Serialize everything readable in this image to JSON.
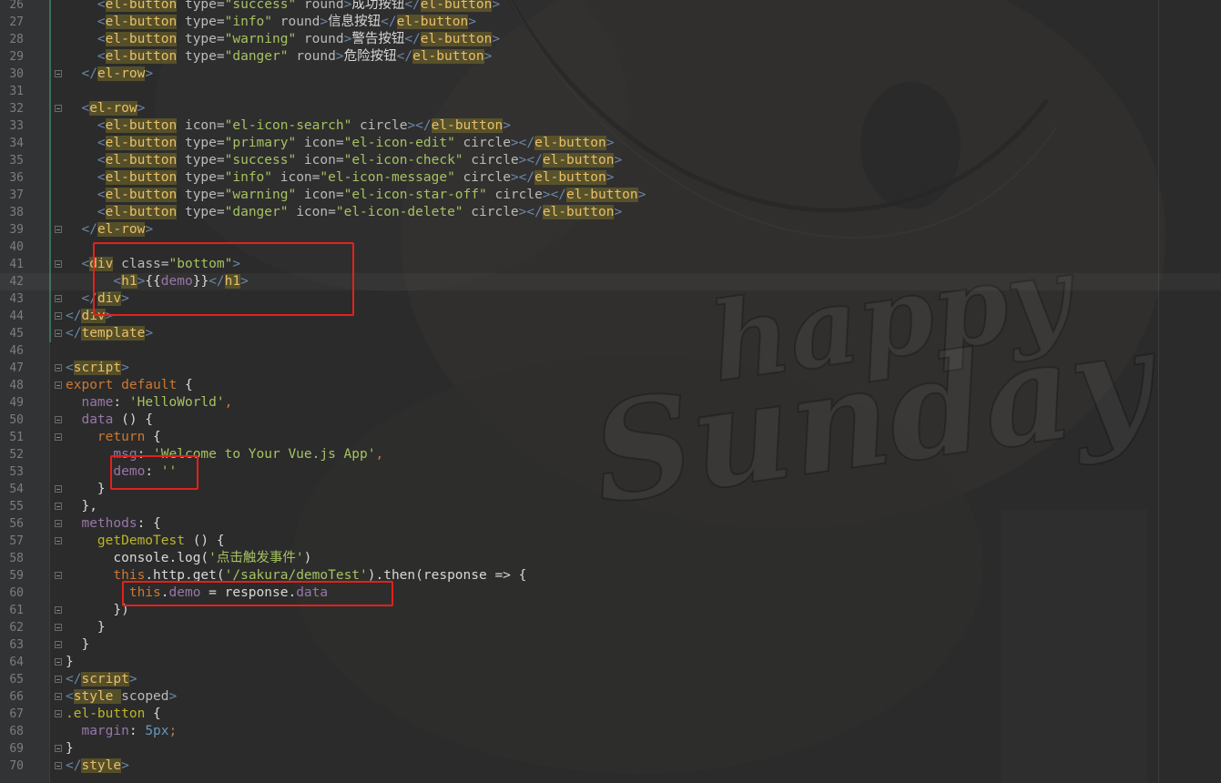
{
  "editor": {
    "watermark_lines": [
      "happy",
      "Sunday"
    ],
    "colors": {
      "background": "#2b2b2b",
      "tag": "#e8bf6a",
      "string": "#a5c261",
      "keyword": "#cc7832",
      "property": "#9876aa",
      "number": "#6897bb",
      "highlight_box": "#e3211c"
    },
    "lines": [
      {
        "n": "26",
        "fold": false,
        "t": [
          [
            "    ",
            ""
          ],
          [
            "<",
            "br"
          ],
          [
            "el-button",
            "tg"
          ],
          [
            " type=",
            "at"
          ],
          [
            "\"success\"",
            "sv"
          ],
          [
            " round",
            "at"
          ],
          [
            ">",
            "br"
          ],
          [
            "成功按钮",
            "tx"
          ],
          [
            "</",
            "br"
          ],
          [
            "el-button",
            "tg"
          ],
          [
            ">",
            "br"
          ]
        ]
      },
      {
        "n": "27",
        "fold": false,
        "t": [
          [
            "    ",
            ""
          ],
          [
            "<",
            "br"
          ],
          [
            "el-button",
            "tg"
          ],
          [
            " type=",
            "at"
          ],
          [
            "\"info\"",
            "sv"
          ],
          [
            " round",
            "at"
          ],
          [
            ">",
            "br"
          ],
          [
            "信息按钮",
            "tx"
          ],
          [
            "</",
            "br"
          ],
          [
            "el-button",
            "tg"
          ],
          [
            ">",
            "br"
          ]
        ]
      },
      {
        "n": "28",
        "fold": false,
        "t": [
          [
            "    ",
            ""
          ],
          [
            "<",
            "br"
          ],
          [
            "el-button",
            "tg"
          ],
          [
            " type=",
            "at"
          ],
          [
            "\"warning\"",
            "sv"
          ],
          [
            " round",
            "at"
          ],
          [
            ">",
            "br"
          ],
          [
            "警告按钮",
            "tx"
          ],
          [
            "</",
            "br"
          ],
          [
            "el-button",
            "tg"
          ],
          [
            ">",
            "br"
          ]
        ]
      },
      {
        "n": "29",
        "fold": false,
        "t": [
          [
            "    ",
            ""
          ],
          [
            "<",
            "br"
          ],
          [
            "el-button",
            "tg"
          ],
          [
            " type=",
            "at"
          ],
          [
            "\"danger\"",
            "sv"
          ],
          [
            " round",
            "at"
          ],
          [
            ">",
            "br"
          ],
          [
            "危险按钮",
            "tx"
          ],
          [
            "</",
            "br"
          ],
          [
            "el-button",
            "tg"
          ],
          [
            ">",
            "br"
          ]
        ]
      },
      {
        "n": "30",
        "fold": true,
        "t": [
          [
            "  ",
            ""
          ],
          [
            "</",
            "br"
          ],
          [
            "el-row",
            "tg"
          ],
          [
            ">",
            "br"
          ]
        ]
      },
      {
        "n": "31",
        "fold": false,
        "t": []
      },
      {
        "n": "32",
        "fold": true,
        "t": [
          [
            "  ",
            ""
          ],
          [
            "<",
            "br"
          ],
          [
            "el-row",
            "tg"
          ],
          [
            ">",
            "br"
          ]
        ]
      },
      {
        "n": "33",
        "fold": false,
        "t": [
          [
            "    ",
            ""
          ],
          [
            "<",
            "br"
          ],
          [
            "el-button",
            "tg"
          ],
          [
            " icon=",
            "at"
          ],
          [
            "\"el-icon-search\"",
            "sv"
          ],
          [
            " circle",
            "at"
          ],
          [
            "></",
            "br"
          ],
          [
            "el-button",
            "tg"
          ],
          [
            ">",
            "br"
          ]
        ]
      },
      {
        "n": "34",
        "fold": false,
        "t": [
          [
            "    ",
            ""
          ],
          [
            "<",
            "br"
          ],
          [
            "el-button",
            "tg"
          ],
          [
            " type=",
            "at"
          ],
          [
            "\"primary\"",
            "sv"
          ],
          [
            " icon=",
            "at"
          ],
          [
            "\"el-icon-edit\"",
            "sv"
          ],
          [
            " circle",
            "at"
          ],
          [
            "></",
            "br"
          ],
          [
            "el-button",
            "tg"
          ],
          [
            ">",
            "br"
          ]
        ]
      },
      {
        "n": "35",
        "fold": false,
        "t": [
          [
            "    ",
            ""
          ],
          [
            "<",
            "br"
          ],
          [
            "el-button",
            "tg"
          ],
          [
            " type=",
            "at"
          ],
          [
            "\"success\"",
            "sv"
          ],
          [
            " icon=",
            "at"
          ],
          [
            "\"el-icon-check\"",
            "sv"
          ],
          [
            " circle",
            "at"
          ],
          [
            "></",
            "br"
          ],
          [
            "el-button",
            "tg"
          ],
          [
            ">",
            "br"
          ]
        ]
      },
      {
        "n": "36",
        "fold": false,
        "t": [
          [
            "    ",
            ""
          ],
          [
            "<",
            "br"
          ],
          [
            "el-button",
            "tg"
          ],
          [
            " type=",
            "at"
          ],
          [
            "\"info\"",
            "sv"
          ],
          [
            " icon=",
            "at"
          ],
          [
            "\"el-icon-message\"",
            "sv"
          ],
          [
            " circle",
            "at"
          ],
          [
            "></",
            "br"
          ],
          [
            "el-button",
            "tg"
          ],
          [
            ">",
            "br"
          ]
        ]
      },
      {
        "n": "37",
        "fold": false,
        "t": [
          [
            "    ",
            ""
          ],
          [
            "<",
            "br"
          ],
          [
            "el-button",
            "tg"
          ],
          [
            " type=",
            "at"
          ],
          [
            "\"warning\"",
            "sv"
          ],
          [
            " icon=",
            "at"
          ],
          [
            "\"el-icon-star-off\"",
            "sv"
          ],
          [
            " circle",
            "at"
          ],
          [
            "></",
            "br"
          ],
          [
            "el-button",
            "tg"
          ],
          [
            ">",
            "br"
          ]
        ]
      },
      {
        "n": "38",
        "fold": false,
        "t": [
          [
            "    ",
            ""
          ],
          [
            "<",
            "br"
          ],
          [
            "el-button",
            "tg"
          ],
          [
            " type=",
            "at"
          ],
          [
            "\"danger\"",
            "sv"
          ],
          [
            " icon=",
            "at"
          ],
          [
            "\"el-icon-delete\"",
            "sv"
          ],
          [
            " circle",
            "at"
          ],
          [
            "></",
            "br"
          ],
          [
            "el-button",
            "tg"
          ],
          [
            ">",
            "br"
          ]
        ]
      },
      {
        "n": "39",
        "fold": true,
        "t": [
          [
            "  ",
            ""
          ],
          [
            "</",
            "br"
          ],
          [
            "el-row",
            "tg"
          ],
          [
            ">",
            "br"
          ]
        ]
      },
      {
        "n": "40",
        "fold": false,
        "t": []
      },
      {
        "n": "41",
        "fold": true,
        "t": [
          [
            "  ",
            ""
          ],
          [
            "<",
            "br"
          ],
          [
            "div",
            "tg"
          ],
          [
            " class=",
            "at"
          ],
          [
            "\"bottom\"",
            "sv"
          ],
          [
            ">",
            "br"
          ]
        ]
      },
      {
        "n": "42",
        "fold": false,
        "t": [
          [
            "      ",
            ""
          ],
          [
            "<",
            "br"
          ],
          [
            "h1",
            "tg"
          ],
          [
            ">",
            "br"
          ],
          [
            "{{",
            "tx"
          ],
          [
            "demo",
            "pr"
          ],
          [
            "}}",
            "tx"
          ],
          [
            "</",
            "br"
          ],
          [
            "h1",
            "tg"
          ],
          [
            ">",
            "br"
          ]
        ]
      },
      {
        "n": "43",
        "fold": true,
        "t": [
          [
            "  ",
            ""
          ],
          [
            "</",
            "br"
          ],
          [
            "div",
            "tg"
          ],
          [
            ">",
            "br"
          ]
        ]
      },
      {
        "n": "44",
        "fold": true,
        "t": [
          [
            "",
            ""
          ],
          [
            "</",
            "br"
          ],
          [
            "div",
            "tg"
          ],
          [
            ">",
            "br"
          ]
        ]
      },
      {
        "n": "45",
        "fold": true,
        "t": [
          [
            "</",
            "br"
          ],
          [
            "template",
            "tg"
          ],
          [
            ">",
            "br"
          ]
        ]
      },
      {
        "n": "46",
        "fold": false,
        "t": []
      },
      {
        "n": "47",
        "fold": true,
        "t": [
          [
            "<",
            "br"
          ],
          [
            "script",
            "tg"
          ],
          [
            ">",
            "br"
          ]
        ]
      },
      {
        "n": "48",
        "fold": true,
        "t": [
          [
            "export default ",
            "kw"
          ],
          [
            "{",
            "tx"
          ]
        ]
      },
      {
        "n": "49",
        "fold": false,
        "t": [
          [
            "  name",
            "pr"
          ],
          [
            ": ",
            "tx"
          ],
          [
            "'HelloWorld'",
            "sv"
          ],
          [
            ",",
            "kw"
          ]
        ]
      },
      {
        "n": "50",
        "fold": true,
        "t": [
          [
            "  data ",
            "pr"
          ],
          [
            "() {",
            "tx"
          ]
        ]
      },
      {
        "n": "51",
        "fold": true,
        "t": [
          [
            "    return ",
            "kw"
          ],
          [
            "{",
            "tx"
          ]
        ]
      },
      {
        "n": "52",
        "fold": false,
        "t": [
          [
            "      msg",
            "pr"
          ],
          [
            ": ",
            "tx"
          ],
          [
            "'Welcome to Your Vue.js App'",
            "sv"
          ],
          [
            ",",
            "kw"
          ]
        ]
      },
      {
        "n": "53",
        "fold": false,
        "t": [
          [
            "      demo",
            "pr"
          ],
          [
            ": ",
            "tx"
          ],
          [
            "''",
            "sv"
          ]
        ]
      },
      {
        "n": "54",
        "fold": true,
        "t": [
          [
            "    }",
            "tx"
          ]
        ]
      },
      {
        "n": "55",
        "fold": true,
        "t": [
          [
            "  },",
            "tx"
          ]
        ]
      },
      {
        "n": "56",
        "fold": true,
        "t": [
          [
            "  methods",
            "pr"
          ],
          [
            ": {",
            "tx"
          ]
        ]
      },
      {
        "n": "57",
        "fold": true,
        "t": [
          [
            "    getDemoTest ",
            "sel"
          ],
          [
            "() {",
            "tx"
          ]
        ]
      },
      {
        "n": "58",
        "fold": false,
        "t": [
          [
            "      console",
            "tx"
          ],
          [
            ".log(",
            "tx"
          ],
          [
            "'点击触发事件'",
            "sv"
          ],
          [
            ")",
            "tx"
          ]
        ]
      },
      {
        "n": "59",
        "fold": true,
        "t": [
          [
            "      this",
            "kw"
          ],
          [
            ".http.get(",
            "tx"
          ],
          [
            "'/sakura/demoTest'",
            "sv"
          ],
          [
            ").then(response => {",
            "tx"
          ]
        ]
      },
      {
        "n": "60",
        "fold": false,
        "t": [
          [
            "        this",
            "kw"
          ],
          [
            ".",
            "tx"
          ],
          [
            "demo",
            "pr"
          ],
          [
            " = response.",
            "tx"
          ],
          [
            "data",
            "pr"
          ]
        ]
      },
      {
        "n": "61",
        "fold": true,
        "t": [
          [
            "      })",
            "tx"
          ]
        ]
      },
      {
        "n": "62",
        "fold": true,
        "t": [
          [
            "    }",
            "tx"
          ]
        ]
      },
      {
        "n": "63",
        "fold": true,
        "t": [
          [
            "  }",
            "tx"
          ]
        ]
      },
      {
        "n": "64",
        "fold": true,
        "t": [
          [
            "}",
            "tx"
          ]
        ]
      },
      {
        "n": "65",
        "fold": true,
        "t": [
          [
            "</",
            "br"
          ],
          [
            "script",
            "tg"
          ],
          [
            ">",
            "br"
          ]
        ]
      },
      {
        "n": "66",
        "fold": true,
        "t": [
          [
            "<",
            "br"
          ],
          [
            "style ",
            "tg"
          ],
          [
            "scoped",
            "at"
          ],
          [
            ">",
            "br"
          ]
        ]
      },
      {
        "n": "67",
        "fold": true,
        "t": [
          [
            ".el-button ",
            "sel"
          ],
          [
            "{",
            "tx"
          ]
        ]
      },
      {
        "n": "68",
        "fold": false,
        "t": [
          [
            "  margin",
            "pr"
          ],
          [
            ": ",
            "tx"
          ],
          [
            "5px",
            "nm"
          ],
          [
            ";",
            "kw"
          ]
        ]
      },
      {
        "n": "69",
        "fold": true,
        "t": [
          [
            "}",
            "tx"
          ]
        ]
      },
      {
        "n": "70",
        "fold": true,
        "t": [
          [
            "</",
            "br"
          ],
          [
            "style",
            "tg"
          ],
          [
            ">",
            "br"
          ]
        ]
      }
    ]
  }
}
